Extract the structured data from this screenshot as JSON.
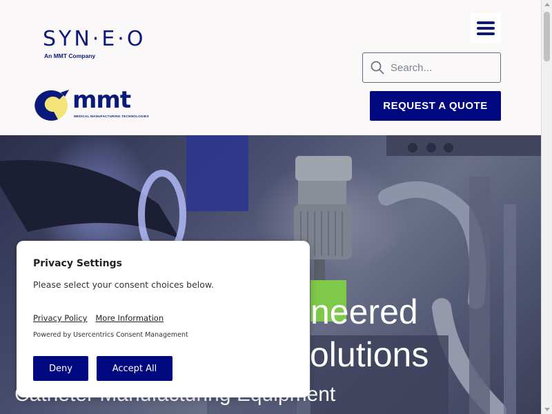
{
  "header": {
    "brand_name": "SYN·E·O",
    "brand_tagline": "An MMT Company",
    "partner_name": "mmt",
    "partner_tagline": "MEDICAL MANUFACTURING TECHNOLOGIES",
    "search_placeholder": "Search...",
    "quote_button": "REQUEST A QUOTE",
    "menu_icon": "hamburger-icon",
    "search_icon": "magnifier-icon"
  },
  "hero": {
    "line1": "neered",
    "line2": "olutions",
    "line3": "Catheter Manufacturing Equipment"
  },
  "consent": {
    "title": "Privacy Settings",
    "description": "Please select your consent choices below.",
    "link_privacy": "Privacy Policy",
    "link_more": "More Information",
    "powered_by": "Powered by Usercentrics Consent Management",
    "deny_button": "Deny",
    "accept_button": "Accept All"
  },
  "colors": {
    "brand_navy": "#0a1a7a",
    "button_blue": "#00087f",
    "logo_yellow": "#f3e47a",
    "background": "#fbf8f9"
  }
}
